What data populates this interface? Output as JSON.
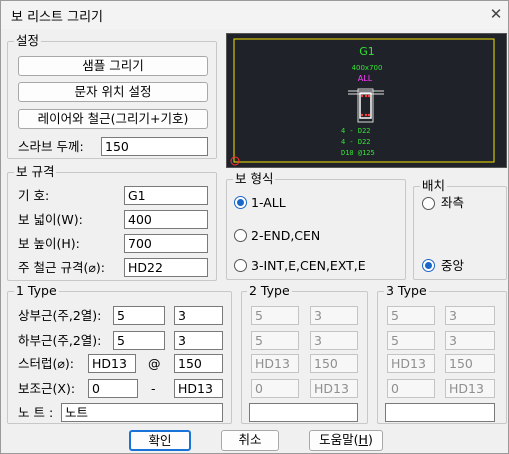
{
  "window": {
    "title": "보 리스트 그리기",
    "close": "✕"
  },
  "settings": {
    "group_label": "설정",
    "sample_btn": "샘플 그리기",
    "text_pos_btn": "문자 위치 설정",
    "layer_btn": "레이어와 철근(그리기+기호)",
    "slab_label": "스라브 두께:",
    "slab_value": "150"
  },
  "preview": {
    "name": "G1",
    "size": "400x700",
    "type": "ALL",
    "rows": [
      "4 - D22",
      "4 - D22",
      "D10 @125"
    ]
  },
  "spec": {
    "group_label": "보 규격",
    "symbol_label": "기 호:",
    "symbol_value": "G1",
    "width_label": "보 넓이(W):",
    "width_value": "400",
    "height_label": "보 높이(H):",
    "height_value": "700",
    "rebar_label": "주 철근 규격(⌀):",
    "rebar_value": "HD22"
  },
  "shape": {
    "group_label": "보 형식",
    "options": [
      "1-ALL",
      "2-END,CEN",
      "3-INT,E,CEN,EXT,E"
    ],
    "selected": 0
  },
  "placement": {
    "group_label": "배치",
    "options": [
      "좌측",
      "중앙"
    ],
    "selected": 1
  },
  "type1": {
    "group_label": "1 Type",
    "top_label": "상부근(주,2열):",
    "top_a": "5",
    "top_b": "3",
    "bot_label": "하부근(주,2열):",
    "bot_a": "5",
    "bot_b": "3",
    "stirrup_label": "스터럽(⌀):",
    "stirrup_a": "HD13",
    "at": "@",
    "stirrup_b": "150",
    "aux_label": "보조근(X):",
    "aux_a": "0",
    "dash": "-",
    "aux_b": "HD13",
    "note_label": "노 트 :",
    "note_value": "노트"
  },
  "type2": {
    "group_label": "2 Type",
    "top_a": "5",
    "top_b": "3",
    "bot_a": "5",
    "bot_b": "3",
    "stirrup_a": "HD13",
    "stirrup_b": "150",
    "aux_a": "0",
    "aux_b": "HD13",
    "note_value": ""
  },
  "type3": {
    "group_label": "3 Type",
    "top_a": "5",
    "top_b": "3",
    "bot_a": "5",
    "bot_b": "3",
    "stirrup_a": "HD13",
    "stirrup_b": "150",
    "aux_a": "0",
    "aux_b": "HD13",
    "note_value": ""
  },
  "buttons": {
    "ok": "확인",
    "cancel": "취소",
    "help_text": "도움말(",
    "help_key": "H",
    "help_close": ")"
  }
}
